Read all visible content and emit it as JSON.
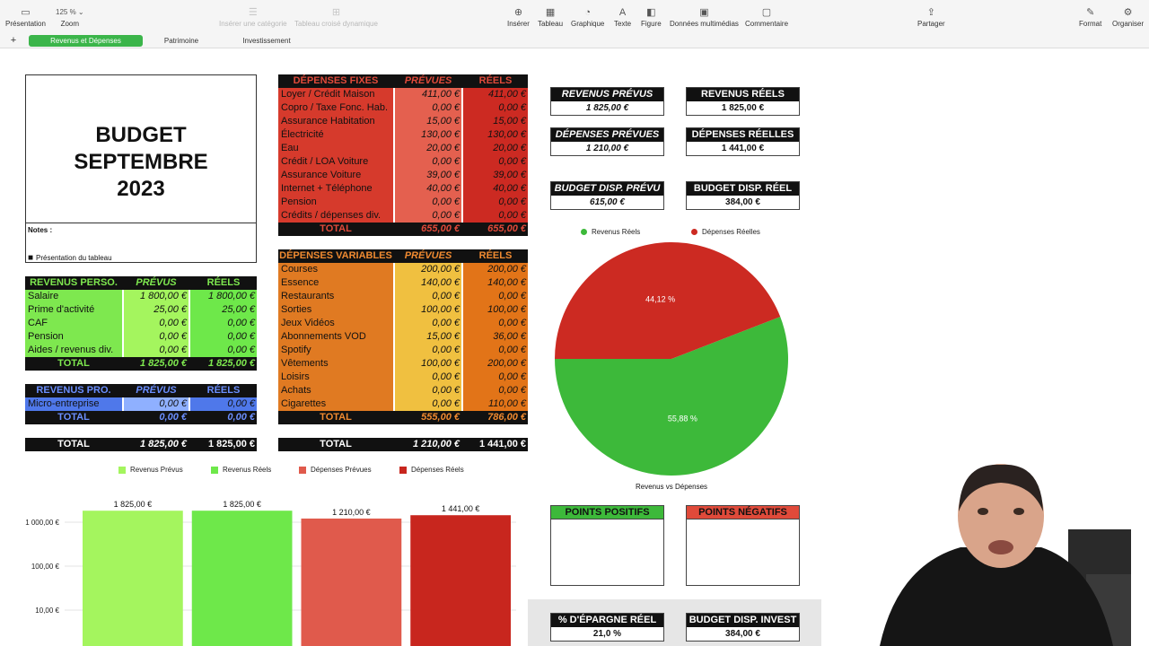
{
  "toolbar": {
    "zoom_value": "125 %",
    "items": {
      "presentation": "Présentation",
      "zoom": "Zoom",
      "insert_category": "Insérer une catégorie",
      "pivot_table": "Tableau croisé dynamique",
      "insert": "Insérer",
      "table": "Tableau",
      "chart": "Graphique",
      "text": "Texte",
      "shape": "Figure",
      "media": "Données multimédias",
      "comment": "Commentaire",
      "share": "Partager",
      "format": "Format",
      "organize": "Organiser"
    }
  },
  "sheets": {
    "add": "+",
    "tabs": [
      "Revenus et Dépenses",
      "Patrimoine",
      "Investissement"
    ]
  },
  "title": {
    "line1": "BUDGET SEPTEMBRE",
    "line2": "2023"
  },
  "notes": {
    "label": "Notes :",
    "link": "Présentation du tableau"
  },
  "fixed": {
    "header": [
      "DÉPENSES FIXES",
      "PRÉVUES",
      "RÉELS"
    ],
    "rows": [
      [
        "Loyer / Crédit Maison",
        "411,00 €",
        "411,00 €"
      ],
      [
        "Copro / Taxe Fonc. Hab.",
        "0,00 €",
        "0,00 €"
      ],
      [
        "Assurance Habitation",
        "15,00 €",
        "15,00 €"
      ],
      [
        "Électricité",
        "130,00 €",
        "130,00 €"
      ],
      [
        "Eau",
        "20,00 €",
        "20,00 €"
      ],
      [
        "Crédit / LOA Voiture",
        "0,00 €",
        "0,00 €"
      ],
      [
        "Assurance Voiture",
        "39,00 €",
        "39,00 €"
      ],
      [
        "Internet + Téléphone",
        "40,00 €",
        "40,00 €"
      ],
      [
        "Pension",
        "0,00 €",
        "0,00 €"
      ],
      [
        "Crédits / dépenses div.",
        "0,00 €",
        "0,00 €"
      ]
    ],
    "total": [
      "TOTAL",
      "655,00 €",
      "655,00 €"
    ]
  },
  "variable": {
    "header": [
      "DÉPENSES VARIABLES",
      "PRÉVUES",
      "RÉELS"
    ],
    "rows": [
      [
        "Courses",
        "200,00 €",
        "200,00 €"
      ],
      [
        "Essence",
        "140,00 €",
        "140,00 €"
      ],
      [
        "Restaurants",
        "0,00 €",
        "0,00 €"
      ],
      [
        "Sorties",
        "100,00 €",
        "100,00 €"
      ],
      [
        "Jeux Vidéos",
        "0,00 €",
        "0,00 €"
      ],
      [
        "Abonnements VOD",
        "15,00 €",
        "36,00 €"
      ],
      [
        "Spotify",
        "0,00 €",
        "0,00 €"
      ],
      [
        "Vêtements",
        "100,00 €",
        "200,00 €"
      ],
      [
        "Loisirs",
        "0,00 €",
        "0,00 €"
      ],
      [
        "Achats",
        "0,00 €",
        "0,00 €"
      ],
      [
        "Cigarettes",
        "0,00 €",
        "110,00 €"
      ]
    ],
    "total": [
      "TOTAL",
      "555,00 €",
      "786,00 €"
    ]
  },
  "perso": {
    "header": [
      "REVENUS PERSO.",
      "PRÉVUS",
      "RÉELS"
    ],
    "rows": [
      [
        "Salaire",
        "1 800,00 €",
        "1 800,00 €"
      ],
      [
        "Prime d'activité",
        "25,00 €",
        "25,00 €"
      ],
      [
        "CAF",
        "0,00 €",
        "0,00 €"
      ],
      [
        "Pension",
        "0,00 €",
        "0,00 €"
      ],
      [
        "Aides / revenus div.",
        "0,00 €",
        "0,00 €"
      ]
    ],
    "total": [
      "TOTAL",
      "1 825,00 €",
      "1 825,00 €"
    ]
  },
  "pro": {
    "header": [
      "REVENUS PRO.",
      "PRÉVUS",
      "RÉELS"
    ],
    "rows": [
      [
        "Micro-entreprise",
        "0,00 €",
        "0,00 €"
      ]
    ],
    "total": [
      "TOTAL",
      "0,00 €",
      "0,00 €"
    ]
  },
  "grand_income": [
    "TOTAL",
    "1 825,00 €",
    "1 825,00 €"
  ],
  "grand_expense": [
    "TOTAL",
    "1 210,00 €",
    "1 441,00 €"
  ],
  "cards": {
    "rev_prev": [
      "REVENUS PRÉVUS",
      "1 825,00 €"
    ],
    "rev_real": [
      "REVENUS RÉELS",
      "1 825,00 €"
    ],
    "dep_prev": [
      "DÉPENSES PRÉVUES",
      "1 210,00 €"
    ],
    "dep_real": [
      "DÉPENSES RÉELLES",
      "1 441,00 €"
    ],
    "bud_prev": [
      "BUDGET DISP. PRÉVU",
      "615,00 €"
    ],
    "bud_real": [
      "BUDGET DISP. RÉEL",
      "384,00 €"
    ],
    "epargne": [
      "% D'ÉPARGNE RÉEL",
      "21,0 %"
    ],
    "invest": [
      "BUDGET DISP. INVEST",
      "384,00 €"
    ]
  },
  "points": {
    "positive": "POINTS POSITIFS",
    "negative": "POINTS NÉGATIFS"
  },
  "colors": {
    "green": "#3db93a",
    "red": "#cc2a22",
    "orange": "#e07a22",
    "yellow": "#f0c040",
    "light_green": "#7ee84f",
    "blue": "#4f78ea"
  },
  "chart_data": [
    {
      "type": "pie",
      "title": "Revenus vs Dépenses",
      "legend": [
        "Revenus Réels",
        "Dépenses Réelles"
      ],
      "values": [
        55.88,
        44.12
      ],
      "labels": [
        "55,88 %",
        "44,12 %"
      ],
      "colors": [
        "#3db93a",
        "#cc2a22"
      ]
    },
    {
      "type": "bar",
      "scale": "log",
      "categories": [
        "Revenus Prévus",
        "Revenus Réels",
        "Dépenses Prévues",
        "Dépenses Réels"
      ],
      "values": [
        1825,
        1825,
        1210,
        1441
      ],
      "data_labels": [
        "1 825,00 €",
        "1 825,00 €",
        "1 210,00 €",
        "1 441,00 €"
      ],
      "ticks": [
        {
          "value": 1000,
          "label": "1 000,00 €"
        },
        {
          "value": 100,
          "label": "100,00 €"
        },
        {
          "value": 10,
          "label": "10,00 €"
        }
      ],
      "colors": [
        "#a4f55e",
        "#6ee84a",
        "#e05a4c",
        "#c8261e"
      ]
    }
  ]
}
